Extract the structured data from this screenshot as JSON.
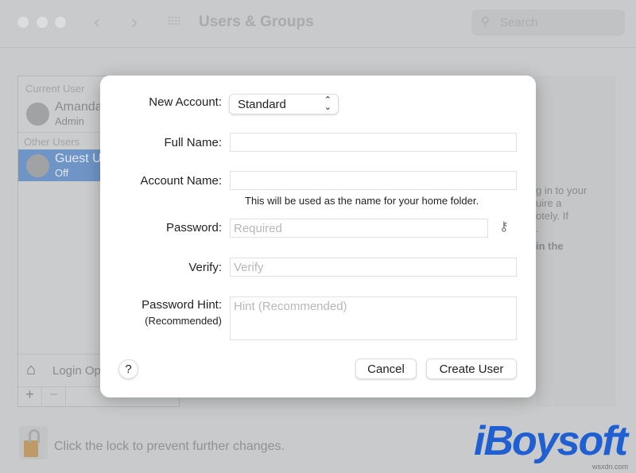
{
  "window": {
    "title": "Users & Groups",
    "search_placeholder": "Search"
  },
  "sidebar": {
    "current_user_header": "Current User",
    "current_user": {
      "name": "Amanda",
      "role": "Admin"
    },
    "other_users_header": "Other Users",
    "other_user": {
      "name": "Guest U",
      "status": "Off"
    },
    "login_options": "Login Op",
    "add": "+",
    "remove": "−"
  },
  "right_pane": {
    "lines": [
      "g in to your",
      "uire a",
      "otely. If",
      "."
    ],
    "bold_line": "in the"
  },
  "lock": {
    "text": "Click the lock to prevent further changes."
  },
  "dialog": {
    "new_account_label": "New Account:",
    "new_account_value": "Standard",
    "full_name_label": "Full Name:",
    "full_name_value": "",
    "account_name_label": "Account Name:",
    "account_name_value": "",
    "account_name_hint": "This will be used as the name for your home folder.",
    "password_label": "Password:",
    "password_placeholder": "Required",
    "verify_label": "Verify:",
    "verify_placeholder": "Verify",
    "hint_label": "Password Hint:",
    "hint_sublabel": "(Recommended)",
    "hint_placeholder": "Hint (Recommended)",
    "help": "?",
    "cancel": "Cancel",
    "create": "Create User"
  },
  "watermark": {
    "logo": "iBoysoft",
    "site": "wsxdn.com"
  },
  "colors": {
    "selection": "#6f95c6",
    "logo": "#1f5fd1"
  }
}
